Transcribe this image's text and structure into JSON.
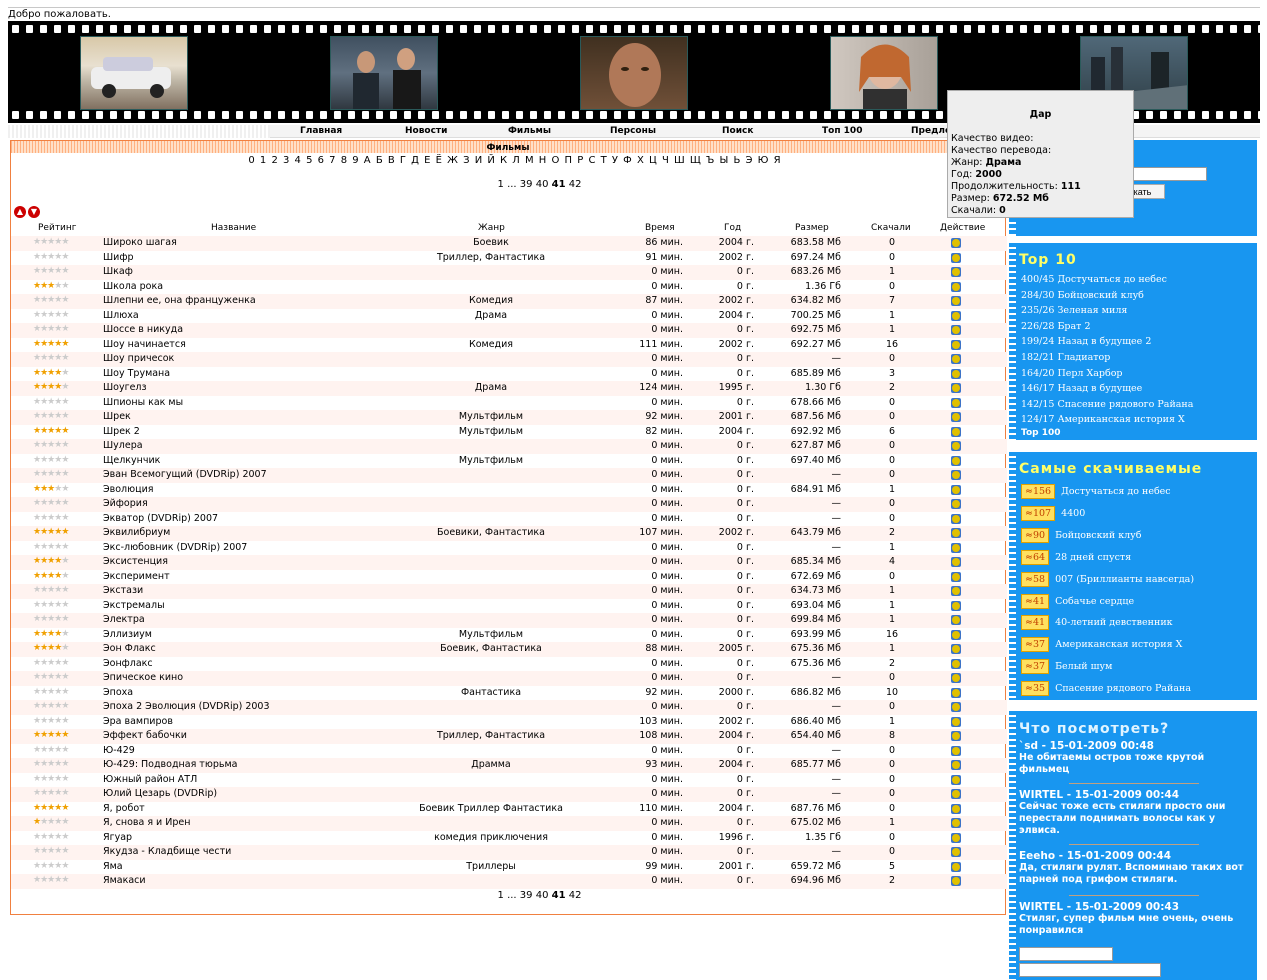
{
  "welcome": "Добро пожаловать.",
  "nav": [
    "Главная",
    "Новости",
    "Фильмы",
    "Персоны",
    "Поиск",
    "Топ 100",
    "Предло"
  ],
  "main": {
    "title": "Фильмы",
    "alphabet": "0 1 2 3 4 5 6 7 8 9 А Б В Г Д Е Ё Ж З И Й К Л М Н О П Р С Т У Ф Х Ц Ч Ш Щ Ъ Ы Ь Э Ю Я",
    "pager": {
      "first": "1",
      "dots": "...",
      "p1": "39",
      "p2": "40",
      "current": "41",
      "p3": "42"
    },
    "headers": {
      "rating": "Рейтинг",
      "name": "Название",
      "genre": "Жанр",
      "time": "Время",
      "year": "Год",
      "size": "Размер",
      "downloads": "Скачали",
      "action": "Действие"
    }
  },
  "films": [
    {
      "stars": 0,
      "name": "Широко шагая",
      "genre": "Боевик",
      "time": "86 мин.",
      "year": "2004 г.",
      "size": "683.58 Мб",
      "dl": "0"
    },
    {
      "stars": 0,
      "name": "Шифр",
      "genre": "Триллер, Фантастика",
      "time": "91 мин.",
      "year": "2002 г.",
      "size": "697.24 Мб",
      "dl": "0"
    },
    {
      "stars": 0,
      "name": "Шкаф",
      "genre": "",
      "time": "0 мин.",
      "year": "0 г.",
      "size": "683.26 Мб",
      "dl": "1"
    },
    {
      "stars": 2.5,
      "name": "Школа рока",
      "genre": "",
      "time": "0 мин.",
      "year": "0 г.",
      "size": "1.36 Гб",
      "dl": "0"
    },
    {
      "stars": 0,
      "name": "Шлепни ее, она француженка",
      "genre": "Комедия",
      "time": "87 мин.",
      "year": "2002 г.",
      "size": "634.82 Мб",
      "dl": "7"
    },
    {
      "stars": 0,
      "name": "Шлюха",
      "genre": "Драма",
      "time": "0 мин.",
      "year": "2004 г.",
      "size": "700.25 Мб",
      "dl": "1"
    },
    {
      "stars": 0,
      "name": "Шоссе в никуда",
      "genre": "",
      "time": "0 мин.",
      "year": "0 г.",
      "size": "692.75 Мб",
      "dl": "1"
    },
    {
      "stars": 4.5,
      "name": "Шоу начинается",
      "genre": "Комедия",
      "time": "111 мин.",
      "year": "2002 г.",
      "size": "692.27 Мб",
      "dl": "16"
    },
    {
      "stars": 0,
      "name": "Шоу причесок",
      "genre": "",
      "time": "0 мин.",
      "year": "0 г.",
      "size": "—",
      "dl": "0"
    },
    {
      "stars": 4,
      "name": "Шоу Трумана",
      "genre": "",
      "time": "0 мин.",
      "year": "0 г.",
      "size": "685.89 Мб",
      "dl": "3"
    },
    {
      "stars": 4,
      "name": "Шоугелз",
      "genre": "Драма",
      "time": "124 мин.",
      "year": "1995 г.",
      "size": "1.30 Гб",
      "dl": "2"
    },
    {
      "stars": 0,
      "name": "Шпионы как мы",
      "genre": "",
      "time": "0 мин.",
      "year": "0 г.",
      "size": "678.66 Мб",
      "dl": "0"
    },
    {
      "stars": 0,
      "name": "Шрек",
      "genre": "Мультфильм",
      "time": "92 мин.",
      "year": "2001 г.",
      "size": "687.56 Мб",
      "dl": "0"
    },
    {
      "stars": 4.5,
      "name": "Шрек 2",
      "genre": "Мультфильм",
      "time": "82 мин.",
      "year": "2004 г.",
      "size": "692.92 Мб",
      "dl": "6"
    },
    {
      "stars": 0,
      "name": "Шулера",
      "genre": "",
      "time": "0 мин.",
      "year": "0 г.",
      "size": "627.87 Мб",
      "dl": "0"
    },
    {
      "stars": 0,
      "name": "Щелкунчик",
      "genre": "Мультфильм",
      "time": "0 мин.",
      "year": "0 г.",
      "size": "697.40 Мб",
      "dl": "0"
    },
    {
      "stars": 0,
      "name": "Эван Всемогущий (DVDRip) 2007",
      "genre": "",
      "time": "0 мин.",
      "year": "0 г.",
      "size": "—",
      "dl": "0"
    },
    {
      "stars": 2.5,
      "name": "Эволюция",
      "genre": "",
      "time": "0 мин.",
      "year": "0 г.",
      "size": "684.91 Мб",
      "dl": "1"
    },
    {
      "stars": 0,
      "name": "Эйфория",
      "genre": "",
      "time": "0 мин.",
      "year": "0 г.",
      "size": "—",
      "dl": "0"
    },
    {
      "stars": 0,
      "name": "Экватор (DVDRip) 2007",
      "genre": "",
      "time": "0 мин.",
      "year": "0 г.",
      "size": "—",
      "dl": "0"
    },
    {
      "stars": 5,
      "name": "Эквилибриум",
      "genre": "Боевики, Фантастика",
      "time": "107 мин.",
      "year": "2002 г.",
      "size": "643.79 Мб",
      "dl": "2"
    },
    {
      "stars": 0,
      "name": "Экс-любовник (DVDRip) 2007",
      "genre": "",
      "time": "0 мин.",
      "year": "0 г.",
      "size": "—",
      "dl": "1"
    },
    {
      "stars": 4,
      "name": "Эксистенция",
      "genre": "",
      "time": "0 мин.",
      "year": "0 г.",
      "size": "685.34 Мб",
      "dl": "4"
    },
    {
      "stars": 4,
      "name": "Эксперимент",
      "genre": "",
      "time": "0 мин.",
      "year": "0 г.",
      "size": "672.69 Мб",
      "dl": "0"
    },
    {
      "stars": 0,
      "name": "Экстази",
      "genre": "",
      "time": "0 мин.",
      "year": "0 г.",
      "size": "634.73 Мб",
      "dl": "1"
    },
    {
      "stars": 0,
      "name": "Экстремалы",
      "genre": "",
      "time": "0 мин.",
      "year": "0 г.",
      "size": "693.04 Мб",
      "dl": "1"
    },
    {
      "stars": 0,
      "name": "Электра",
      "genre": "",
      "time": "0 мин.",
      "year": "0 г.",
      "size": "699.84 Мб",
      "dl": "1"
    },
    {
      "stars": 4,
      "name": "Эллизиум",
      "genre": "Мультфильм",
      "time": "0 мин.",
      "year": "0 г.",
      "size": "693.99 Мб",
      "dl": "16"
    },
    {
      "stars": 4,
      "name": "Эон Флакс",
      "genre": "Боевик, Фантастика",
      "time": "88 мин.",
      "year": "2005 г.",
      "size": "675.36 Мб",
      "dl": "1"
    },
    {
      "stars": 0,
      "name": "Эонфлакс",
      "genre": "",
      "time": "0 мин.",
      "year": "0 г.",
      "size": "675.36 Мб",
      "dl": "2"
    },
    {
      "stars": 0,
      "name": "Эпическое кино",
      "genre": "",
      "time": "0 мин.",
      "year": "0 г.",
      "size": "—",
      "dl": "0"
    },
    {
      "stars": 0,
      "name": "Эпоха",
      "genre": "Фантастика",
      "time": "92 мин.",
      "year": "2000 г.",
      "size": "686.82 Мб",
      "dl": "10"
    },
    {
      "stars": 0,
      "name": "Эпоха 2 Эволюция (DVDRip) 2003",
      "genre": "",
      "time": "0 мин.",
      "year": "0 г.",
      "size": "—",
      "dl": "0"
    },
    {
      "stars": 0,
      "name": "Эра вампиров",
      "genre": "",
      "time": "103 мин.",
      "year": "2002 г.",
      "size": "686.40 Мб",
      "dl": "1"
    },
    {
      "stars": 5,
      "name": "Эффект бабочки",
      "genre": "Триллер, Фантастика",
      "time": "108 мин.",
      "year": "2004 г.",
      "size": "654.40 Мб",
      "dl": "8"
    },
    {
      "stars": 0,
      "name": "Ю-429",
      "genre": "",
      "time": "0 мин.",
      "year": "0 г.",
      "size": "—",
      "dl": "0"
    },
    {
      "stars": 0,
      "name": "Ю-429: Подводная тюрьма",
      "genre": "Драмма",
      "time": "93 мин.",
      "year": "2004 г.",
      "size": "685.77 Мб",
      "dl": "0"
    },
    {
      "stars": 0,
      "name": "Южный район АТЛ",
      "genre": "",
      "time": "0 мин.",
      "year": "0 г.",
      "size": "—",
      "dl": "0"
    },
    {
      "stars": 0,
      "name": "Юлий Цезарь (DVDRip)",
      "genre": "",
      "time": "0 мин.",
      "year": "0 г.",
      "size": "—",
      "dl": "0"
    },
    {
      "stars": 4.5,
      "name": "Я, робот",
      "genre": "Боевик Триллер Фантастика",
      "time": "110 мин.",
      "year": "2004 г.",
      "size": "687.76 Мб",
      "dl": "0"
    },
    {
      "stars": 1,
      "name": "Я, снова я и Ирен",
      "genre": "",
      "time": "0 мин.",
      "year": "0 г.",
      "size": "675.02 Мб",
      "dl": "1"
    },
    {
      "stars": 0,
      "name": "Ягуар",
      "genre": "комедия приключения",
      "time": "0 мин.",
      "year": "1996 г.",
      "size": "1.35 Гб",
      "dl": "0"
    },
    {
      "stars": 0,
      "name": "Якудза - Кладбище чести",
      "genre": "",
      "time": "0 мин.",
      "year": "0 г.",
      "size": "—",
      "dl": "0"
    },
    {
      "stars": 0,
      "name": "Яма",
      "genre": "Триллеры",
      "time": "99 мин.",
      "year": "2001 г.",
      "size": "659.72 Мб",
      "dl": "5"
    },
    {
      "stars": 0,
      "name": "Ямакаси",
      "genre": "",
      "time": "0 мин.",
      "year": "0 г.",
      "size": "694.96 Мб",
      "dl": "2"
    }
  ],
  "tooltip": {
    "title": "Дар",
    "video": "Качество видео:",
    "trans": "Качество перевода:",
    "genre_l": "Жанр:",
    "genre_v": "Драма",
    "year_l": "Год:",
    "year_v": "2000",
    "dur_l": "Продолжительность:",
    "dur_v": "111",
    "size_l": "Размер:",
    "size_v": "672.52 Мб",
    "dl_l": "Скачали:",
    "dl_v": "0"
  },
  "search": {
    "button": "Искать",
    "value": ""
  },
  "top10": {
    "title": "Top 10",
    "items": [
      "400/45 Достучаться до небес",
      "284/30 Бойцовский клуб",
      "235/26 Зеленая миля",
      "226/28 Брат 2",
      "199/24 Назад в будущее 2",
      "182/21 Гладиатор",
      "164/20 Перл Харбор",
      "146/17 Назад в будущее",
      "142/15 Спасение рядового Райана",
      "124/17 Американская история Х"
    ],
    "more": "Top 100"
  },
  "mostdl": {
    "title": "Самые скачиваемые",
    "items": [
      {
        "n": "≈156",
        "t": "Достучаться до небес"
      },
      {
        "n": "≈107",
        "t": "4400"
      },
      {
        "n": "≈90",
        "t": "Бойцовский клуб"
      },
      {
        "n": "≈64",
        "t": "28 дней спустя"
      },
      {
        "n": "≈58",
        "t": "007 (Бриллианты навсегда)"
      },
      {
        "n": "≈41",
        "t": "Собачье сердце"
      },
      {
        "n": "≈41",
        "t": "40-летний девственник"
      },
      {
        "n": "≈37",
        "t": "Американская история Х"
      },
      {
        "n": "≈37",
        "t": "Белый шум"
      },
      {
        "n": "≈35",
        "t": "Спасение рядового Райана"
      }
    ]
  },
  "watch": {
    "title": "Что посмотреть?",
    "comments": [
      {
        "h": "`sd - 15-01-2009 00:48",
        "t": "Не обитаемы остров тоже крутой фильмец"
      },
      {
        "h": "WIRTEL - 15-01-2009 00:44",
        "t": "Сейчас тоже есть стиляги просто они перестали поднимать волосы как у элвиса."
      },
      {
        "h": "Eeeho - 15-01-2009 00:44",
        "t": "Да, стиляги рулят. Вспоминаю таких вот парней под грифом стиляги."
      },
      {
        "h": "WIRTEL - 15-01-2009 00:43",
        "t": "Стиляг, супер фильм мне очень, очень понравился"
      }
    ]
  },
  "colors": {
    "accent": "#1896f0",
    "border": "#f08040",
    "star": "#f0a000"
  }
}
